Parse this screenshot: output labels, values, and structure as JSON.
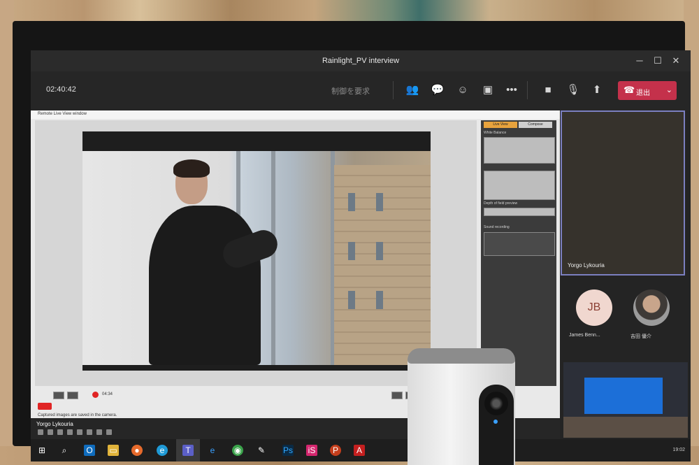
{
  "window": {
    "title": "Rainlight_PV interview"
  },
  "toolbar": {
    "timer": "02:40:42",
    "request_control": "制御を要求",
    "leave_label": "退出"
  },
  "remote_window": {
    "title": "Remote Live View window",
    "tabs": [
      "Live View",
      "Compose"
    ],
    "section_white_balance": "White Balance",
    "section_depth": "Depth of field preview",
    "section_sound": "Sound recording",
    "rec_time": "04:34",
    "saved_note": "Captured images are saved in the camera."
  },
  "participants": {
    "large_tile_name": "Yorgo Lykouria",
    "avatar_initials": "JB",
    "person1_name": "James Benn...",
    "person2_name": "吉田 優介"
  },
  "shared_strip": {
    "presenter_name": "Yorgo Lykouria"
  },
  "taskbar": {
    "time": "19:02"
  },
  "colors": {
    "leave": "#c4314b",
    "accent": "#7b7fc0",
    "record": "#e02424"
  }
}
